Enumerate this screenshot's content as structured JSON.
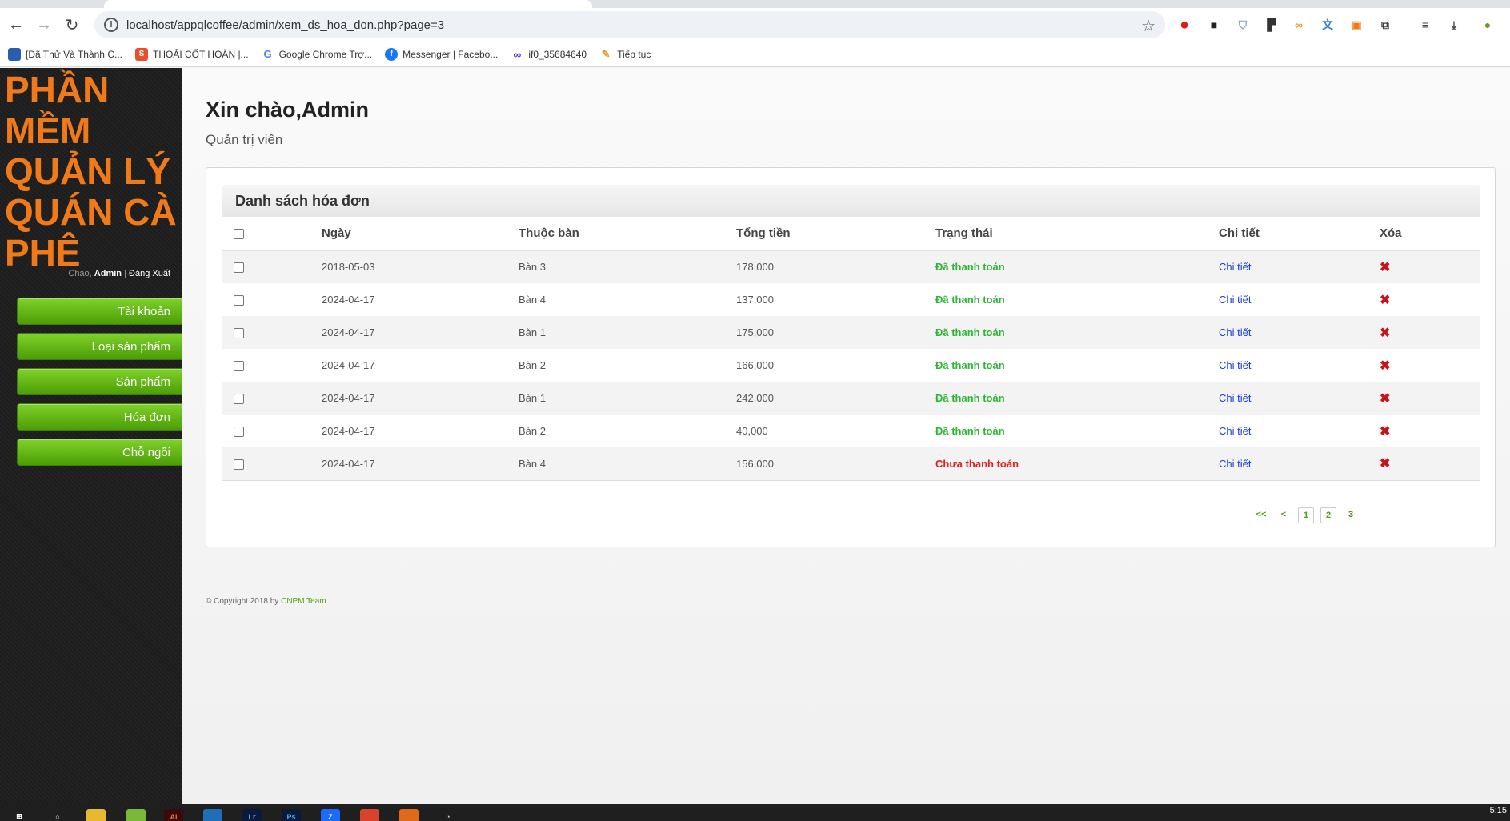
{
  "browser": {
    "url": "localhost/appqlcoffee/admin/xem_ds_hoa_don.php?page=3",
    "bookmarks": [
      {
        "label": "[Đã Thử Và Thành C...",
        "icon": "blue-square-icon",
        "color": "#2a5db0"
      },
      {
        "label": "THOẢI CỐT HOÀN |...",
        "icon": "shopee-bag-icon",
        "color": "#ee4d2d"
      },
      {
        "label": "Google Chrome Trợ...",
        "icon": "google-g-icon",
        "color": "#4285f4"
      },
      {
        "label": "Messenger | Facebo...",
        "icon": "facebook-icon",
        "color": "#1877f2"
      },
      {
        "label": "if0_35684640",
        "icon": "infinity-icon",
        "color": "#5a3fd4"
      },
      {
        "label": "Tiếp tục",
        "icon": "feather-icon",
        "color": "#e0a020"
      }
    ]
  },
  "sidebar": {
    "brand": "PHẦN MỀM QUẢN LÝ QUÁN CÀ PHÊ",
    "greeting_prefix": "Chào,",
    "user": "Admin",
    "separator": "|",
    "logout": "Đăng Xuất",
    "menu": [
      "Tài khoản",
      "Loại sản phẩm",
      "Sản phẩm",
      "Hóa đơn",
      "Chỗ ngồi"
    ]
  },
  "main": {
    "hello": "Xin chào,Admin",
    "role": "Quản trị viên",
    "panel_title": "Danh sách hóa đơn",
    "columns": [
      "Ngày",
      "Thuộc bàn",
      "Tổng tiền",
      "Trạng thái",
      "Chi tiết",
      "Xóa"
    ],
    "rows": [
      {
        "date": "2018-05-03",
        "table": "Bàn 3",
        "total": "178,000",
        "status": "Đã thanh toán",
        "paid": true,
        "detail": "Chi tiết"
      },
      {
        "date": "2024-04-17",
        "table": "Bàn 4",
        "total": "137,000",
        "status": "Đã thanh toán",
        "paid": true,
        "detail": "Chi tiết"
      },
      {
        "date": "2024-04-17",
        "table": "Bàn 1",
        "total": "175,000",
        "status": "Đã thanh toán",
        "paid": true,
        "detail": "Chi tiết"
      },
      {
        "date": "2024-04-17",
        "table": "Bàn 2",
        "total": "166,000",
        "status": "Đã thanh toán",
        "paid": true,
        "detail": "Chi tiết"
      },
      {
        "date": "2024-04-17",
        "table": "Bàn 1",
        "total": "242,000",
        "status": "Đã thanh toán",
        "paid": true,
        "detail": "Chi tiết"
      },
      {
        "date": "2024-04-17",
        "table": "Bàn 2",
        "total": "40,000",
        "status": "Đã thanh toán",
        "paid": true,
        "detail": "Chi tiết"
      },
      {
        "date": "2024-04-17",
        "table": "Bàn 4",
        "total": "156,000",
        "status": "Chưa thanh toán",
        "paid": false,
        "detail": "Chi tiết"
      }
    ],
    "pager": {
      "first": "<<",
      "prev": "<",
      "pages": [
        "1",
        "2",
        "3"
      ],
      "current": "3"
    },
    "footer_prefix": "© Copyright 2018 by",
    "footer_team": "CNPM Team"
  },
  "colors": {
    "brand_orange": "#f07a1a",
    "menu_green": "#5fb312",
    "paid_green": "#2db634",
    "unpaid_red": "#e31b1b",
    "link_blue": "#1b3fd6"
  },
  "taskbar": {
    "clock": "5:15"
  }
}
